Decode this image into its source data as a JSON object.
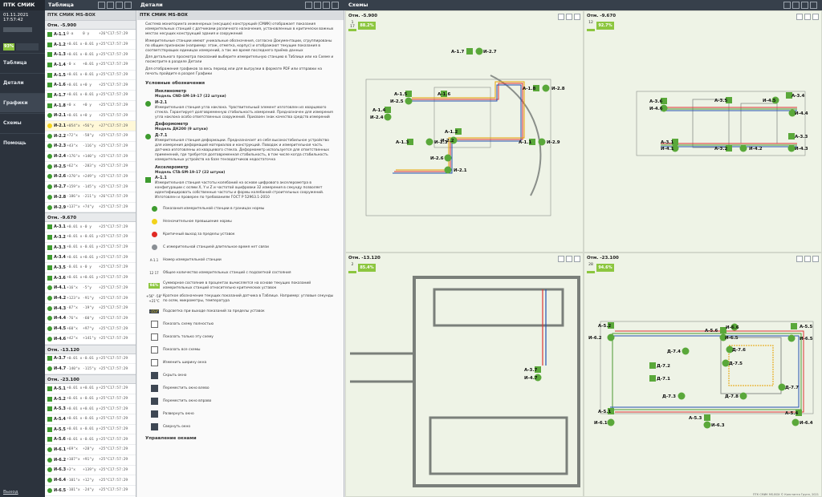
{
  "app": {
    "title": "ПТК СМИК МS-BOX",
    "datetime": "01.11.2021 17:57:42",
    "status_pct": "93%",
    "footer": "ПТК СМИК MS-BOX © Константа Групп, 2021"
  },
  "nav": {
    "items": [
      "Таблица",
      "Детали",
      "Графики",
      "Схемы",
      "Помощь"
    ],
    "active": "Графики",
    "logout": "Выход"
  },
  "panels": {
    "table_title": "Таблица",
    "details_title": "Детали",
    "schemes_title": "Схемы",
    "details_header": "ПТК СМИК МS-BOX"
  },
  "table": {
    "levels": [
      {
        "title": "Отм. -5.900",
        "rows": [
          {
            "name": "А-1.1",
            "v1": "0 α",
            "v2": "0 γ",
            "v3": "+26°C",
            "t": "17:57:29",
            "shape": "sq",
            "color": "#3e9b2f"
          },
          {
            "name": "А-1.2",
            "v1": "+0.01 x",
            "v2": "-0.01 y",
            "v3": "+25°C",
            "t": "17:57:29",
            "shape": "sq",
            "color": "#3e9b2f"
          },
          {
            "name": "А-1.3",
            "v1": "+0.01 x",
            "v2": "-0.01 y",
            "v3": "+25°C",
            "t": "17:57:29",
            "shape": "sq",
            "color": "#3e9b2f"
          },
          {
            "name": "А-1.4",
            "v1": "-0 x",
            "v2": "+0.01 y",
            "v3": "+25°C",
            "t": "17:57:29",
            "shape": "sq",
            "color": "#3e9b2f"
          },
          {
            "name": "А-1.5",
            "v1": "+0.01 x",
            "v2": "-0.01 y",
            "v3": "+25°C",
            "t": "17:57:29",
            "shape": "sq",
            "color": "#3e9b2f"
          },
          {
            "name": "А-1.6",
            "v1": "+0.01 x",
            "v2": "+0 y",
            "v3": "+25°C",
            "t": "17:57:29",
            "shape": "sq",
            "color": "#3e9b2f"
          },
          {
            "name": "А-1.7",
            "v1": "+0.01 x",
            "v2": "-0.01 y",
            "v3": "+25°C",
            "t": "17:57:29",
            "shape": "sq",
            "color": "#3e9b2f"
          },
          {
            "name": "А-1.8",
            "v1": "+0 x",
            "v2": "+0 y",
            "v3": "+25°C",
            "t": "17:57:29",
            "shape": "sq",
            "color": "#3e9b2f"
          },
          {
            "name": "И-2.1",
            "v1": "+0.01 x",
            "v2": "+0 y",
            "v3": "+25°C",
            "t": "17:57:29",
            "shape": "circ",
            "color": "#3e9b2f"
          },
          {
            "name": "И-2.1",
            "v1": "+054\"x",
            "v2": "+56\"y",
            "v3": "+27°C",
            "t": "17:57:29",
            "shape": "circ",
            "color": "#f2d21b",
            "hl": true
          },
          {
            "name": "И-2.2",
            "v1": "+72\"x",
            "v2": "-58\"y",
            "v3": "+25°C",
            "t": "17:57:29",
            "shape": "circ",
            "color": "#3e9b2f"
          },
          {
            "name": "И-2.3",
            "v1": "+43\"x",
            "v2": "-116\"y",
            "v3": "+25°C",
            "t": "17:57:29",
            "shape": "circ",
            "color": "#3e9b2f"
          },
          {
            "name": "И-2.4",
            "v1": "+176\"x",
            "v2": "+140\"y",
            "v3": "+25°C",
            "t": "17:57:29",
            "shape": "circ",
            "color": "#3e9b2f"
          },
          {
            "name": "И-2.5",
            "v1": "+62\"x",
            "v2": "-283\"y",
            "v3": "+25°C",
            "t": "17:57:29",
            "shape": "circ",
            "color": "#3e9b2f"
          },
          {
            "name": "И-2.6",
            "v1": "+370\"x",
            "v2": "+249\"y",
            "v3": "+25°C",
            "t": "17:57:29",
            "shape": "circ",
            "color": "#3e9b2f"
          },
          {
            "name": "И-2.7",
            "v1": "+159\"x",
            "v2": "-145\"y",
            "v3": "+25°C",
            "t": "17:57:29",
            "shape": "circ",
            "color": "#3e9b2f"
          },
          {
            "name": "И-2.8",
            "v1": "-186\"x",
            "v2": "-211\"y",
            "v3": "+26°C",
            "t": "17:57:29",
            "shape": "circ",
            "color": "#3e9b2f"
          },
          {
            "name": "И-2.9",
            "v1": "+137\"x",
            "v2": "+74\"y",
            "v3": "+25°C",
            "t": "17:57:29",
            "shape": "circ",
            "color": "#3e9b2f"
          }
        ]
      },
      {
        "title": "Отм. -9.670",
        "rows": [
          {
            "name": "А-3.1",
            "v1": "+0.01 x",
            "v2": "-0 y",
            "v3": "+25°C",
            "t": "17:57:29",
            "shape": "sq",
            "color": "#3e9b2f"
          },
          {
            "name": "А-3.2",
            "v1": "+0.01 x",
            "v2": "-0.01 y",
            "v3": "+25°C",
            "t": "17:57:29",
            "shape": "sq",
            "color": "#3e9b2f"
          },
          {
            "name": "А-3.3",
            "v1": "+0.01 x",
            "v2": "-0.01 y",
            "v3": "+25°C",
            "t": "17:57:29",
            "shape": "sq",
            "color": "#3e9b2f"
          },
          {
            "name": "А-3.4",
            "v1": "+0.01 x",
            "v2": "+0.01 y",
            "v3": "+25°C",
            "t": "17:57:29",
            "shape": "sq",
            "color": "#3e9b2f"
          },
          {
            "name": "А-3.5",
            "v1": "-0.01 x",
            "v2": "-0 y",
            "v3": "+25°C",
            "t": "17:57:29",
            "shape": "sq",
            "color": "#3e9b2f"
          },
          {
            "name": "А-3.6",
            "v1": "+0.01 x",
            "v2": "+0.01 y",
            "v3": "+25°C",
            "t": "17:57:29",
            "shape": "sq",
            "color": "#3e9b2f"
          },
          {
            "name": "И-4.1",
            "v1": "+16\"x",
            "v2": "-5\"y",
            "v3": "+25°C",
            "t": "17:57:29",
            "shape": "circ",
            "color": "#3e9b2f"
          },
          {
            "name": "И-4.2",
            "v1": "+123\"x",
            "v2": "-91\"y",
            "v3": "+25°C",
            "t": "17:57:29",
            "shape": "circ",
            "color": "#3e9b2f"
          },
          {
            "name": "И-4.3",
            "v1": "-87\"x",
            "v2": "-19\"y",
            "v3": "+25°C",
            "t": "17:57:29",
            "shape": "circ",
            "color": "#3e9b2f"
          },
          {
            "name": "И-4.4",
            "v1": "-76\"x",
            "v2": "-60\"y",
            "v3": "+25°C",
            "t": "17:57:29",
            "shape": "circ",
            "color": "#3e9b2f"
          },
          {
            "name": "И-4.5",
            "v1": "+60\"x",
            "v2": "+97\"y",
            "v3": "+25°C",
            "t": "17:57:29",
            "shape": "circ",
            "color": "#3e9b2f"
          },
          {
            "name": "И-4.6",
            "v1": "+42\"x",
            "v2": "+141\"y",
            "v3": "+25°C",
            "t": "17:57:29",
            "shape": "circ",
            "color": "#3e9b2f"
          }
        ]
      },
      {
        "title": "Отм. -13.120",
        "rows": [
          {
            "name": "А-3.7",
            "v1": "+0.01 x",
            "v2": "-0.01 y",
            "v3": "+25°C",
            "t": "17:57:29",
            "shape": "sq",
            "color": "#3e9b2f"
          },
          {
            "name": "И-4.7",
            "v1": "-140\"x",
            "v2": "-115\"y",
            "v3": "+25°C",
            "t": "17:57:29",
            "shape": "circ",
            "color": "#3e9b2f"
          }
        ]
      },
      {
        "title": "Отм. -23.100",
        "rows": [
          {
            "name": "А-5.1",
            "v1": "+0.01 x",
            "v2": "+0.01 y",
            "v3": "+25°C",
            "t": "17:57:29",
            "shape": "sq",
            "color": "#3e9b2f"
          },
          {
            "name": "А-5.2",
            "v1": "+0.01 x",
            "v2": "-0.01 y",
            "v3": "+25°C",
            "t": "17:57:29",
            "shape": "sq",
            "color": "#3e9b2f"
          },
          {
            "name": "А-5.3",
            "v1": "+0.01 x",
            "v2": "+0.01 y",
            "v3": "+25°C",
            "t": "17:57:29",
            "shape": "sq",
            "color": "#3e9b2f"
          },
          {
            "name": "А-5.4",
            "v1": "+0.01 x",
            "v2": "-0.01 y",
            "v3": "+25°C",
            "t": "17:57:29",
            "shape": "sq",
            "color": "#3e9b2f"
          },
          {
            "name": "А-5.5",
            "v1": "+0.01 x",
            "v2": "-0.01 y",
            "v3": "+25°C",
            "t": "17:57:29",
            "shape": "sq",
            "color": "#3e9b2f"
          },
          {
            "name": "А-5.6",
            "v1": "+0.01 x",
            "v2": "-0.01 y",
            "v3": "+25°C",
            "t": "17:57:29",
            "shape": "sq",
            "color": "#3e9b2f"
          },
          {
            "name": "И-6.1",
            "v1": "+69\"x",
            "v2": "+28\"y",
            "v3": "+25°C",
            "t": "17:57:29",
            "shape": "circ",
            "color": "#3e9b2f"
          },
          {
            "name": "И-6.2",
            "v1": "+107\"x",
            "v2": "+91\"y",
            "v3": "+25°C",
            "t": "17:57:29",
            "shape": "circ",
            "color": "#3e9b2f"
          },
          {
            "name": "И-6.3",
            "v1": "+3\"x",
            "v2": "+139\"y",
            "v3": "+25°C",
            "t": "17:57:29",
            "shape": "circ",
            "color": "#3e9b2f"
          },
          {
            "name": "И-6.4",
            "v1": "-101\"x",
            "v2": "+12\"y",
            "v3": "+25°C",
            "t": "17:57:29",
            "shape": "circ",
            "color": "#3e9b2f"
          },
          {
            "name": "И-6.5",
            "v1": "-101\"x",
            "v2": "-24\"y",
            "v3": "+25°C",
            "t": "17:57:29",
            "shape": "circ",
            "color": "#3e9b2f"
          }
        ]
      }
    ]
  },
  "details": {
    "paragraphs": [
      "Система мониторинга инженерных (несущих) конструкций (СМИК) отображает показания измерительных станций с датчиками различного назначения, установленных в критически важных местах несущих конструкций здания и сооружений",
      "Измерительные станции имеют уникальные обозначения, согласно Документации, сгруппированы по общим признакам (например: этаж, отметка, корпус) и отображают текущие показания в соответствующих единицах измерений, а так же время последнего приёма данных",
      "Для детального просмотра показаний выберите измерительную станцию в Таблице или на Схеме и посмотрите в разделе Детали",
      "Для отображения графиков за весь период или для выгрузки в формате PDF или отправки на печать пройдите в раздел Графики"
    ],
    "legend_title": "Условные обозначения",
    "devices": [
      {
        "kind": "Инклинометр",
        "model": "Модель CND-SM-19-17 (22 штуки)",
        "label": "И-2.1",
        "desc": "Измерительная станция угла наклона. Чувствительный элемент изготовлен из кварцевого стекла. Гарантирует долговременную стабильность измерений. Предназначен для измерения угла наклона особо ответственных сооружений. Присвоен знак качества средств измерений"
      },
      {
        "kind": "Деформометр",
        "model": "Модель ДК200 (9 штуки)",
        "label": "Д-7.1",
        "desc": "Измерительная станция деформации. Предназначает из себя высокостабильное устройство для измерения деформаций материалов и конструкций. Поводок и измерительная часть датчика изготовлены из кварцевого стекла. Деформометр используется для ответственных применений, где требуется долговременная стабильность, в том числе когда стабильность измерительных устройств на базе тензодатчиков недостаточна"
      },
      {
        "kind": "Акселерометр",
        "model": "Модель CTA-SM-19-17 (22 штуки)",
        "label": "А-1.1",
        "desc": "Измерительная станция частоты колебаний на основе цифрового акселерометра в конфигурации с осями X, Y и Z и частотой оцифровки 32 измерения в секунду позволяет идентифицировать собственные частоты и формы колебаний строительных сооружений. Изготовлен и проверен по требованиям ГОСТ Р 52963.1-2010"
      }
    ],
    "legend_items": [
      {
        "sym": "dot",
        "color": "#3e9b2f",
        "text": "Показания измерительной станции в границах нормы"
      },
      {
        "sym": "dot",
        "color": "#f2d21b",
        "text": "Незначительное превышение нормы"
      },
      {
        "sym": "dot",
        "color": "#e02a24",
        "text": "Критичный выход за пределы уставок"
      },
      {
        "sym": "dot",
        "color": "#8a8f95",
        "text": "С измерительной станцией длительное время нет связи"
      },
      {
        "sym": "code",
        "code": "А-1.1",
        "text": "Номер измерительной станции"
      },
      {
        "sym": "count",
        "code": "12 17",
        "text": "Общее количество измерительных станций с подсветкой состояния"
      },
      {
        "sym": "pct",
        "code": "94%",
        "text": "Суммарное состояние в процентах вычисляется на основе текущих показаний измерительных станций относительно критических уставок"
      },
      {
        "sym": "reading",
        "code": "+56\" -58\" +21°C",
        "text": "Краткое обозначение текущих показаний датчика в Таблице. Например: угловые секунды по осям, микрометры, температура"
      },
      {
        "sym": "warn",
        "code": "-153\"",
        "text": "Подсветка при выходе показаний за пределы уставок"
      },
      {
        "sym": "tool",
        "text": "Показать схему полностью"
      },
      {
        "sym": "tool",
        "text": "Показать только эту схему"
      },
      {
        "sym": "tool",
        "text": "Показать все схемы"
      },
      {
        "sym": "tool",
        "text": "Изменить ширину окна"
      },
      {
        "sym": "tooldark",
        "text": "Скрыть окно"
      },
      {
        "sym": "tooldark",
        "text": "Переместить окно влево"
      },
      {
        "sym": "tooldark",
        "text": "Переместить окно вправо"
      },
      {
        "sym": "tooldark",
        "text": "Развернуть окно"
      },
      {
        "sym": "tooldark",
        "text": "Свернуть окно"
      }
    ],
    "bottom_title": "Управление окнами"
  },
  "schemes": [
    {
      "title": "Отм. -5.900",
      "count_a": "1",
      "count_b": "17",
      "pct": "88.2%"
    },
    {
      "title": "Отм. -9.670",
      "count_a": "",
      "count_b": "12",
      "pct": "92.7%"
    },
    {
      "title": "Отм. -13.120",
      "count_a": "",
      "count_b": "2",
      "pct": "85.4%"
    },
    {
      "title": "Отм. -23.100",
      "count_a": "",
      "count_b": "28",
      "pct": "94.6%"
    }
  ],
  "colors": {
    "green": "#3e9b2f",
    "yellow": "#f2d21b",
    "red": "#e02a24",
    "accent": "#8cc63f",
    "nav": "#2c333d"
  }
}
